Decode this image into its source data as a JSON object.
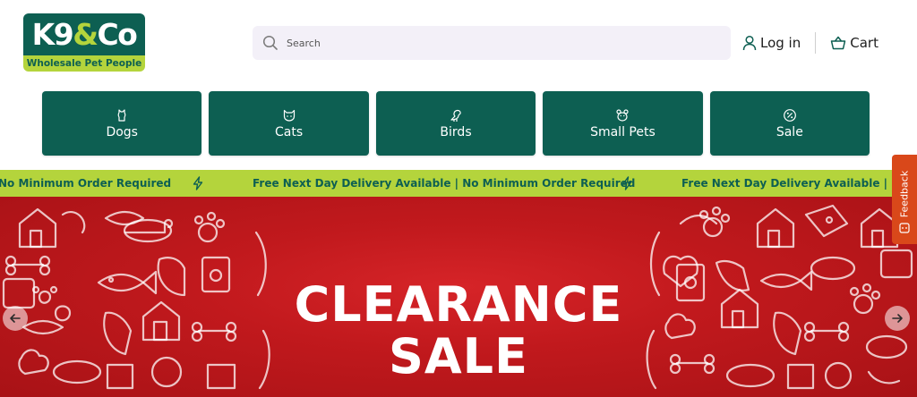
{
  "brand": {
    "name_left": "K9",
    "name_amp": "&",
    "name_right": "Co",
    "tagline": "Wholesale Pet People"
  },
  "search": {
    "placeholder": "Search"
  },
  "header": {
    "login_label": "Log in",
    "cart_label": "Cart"
  },
  "categories": [
    {
      "label": "Dogs",
      "icon": "dog-icon"
    },
    {
      "label": "Cats",
      "icon": "cat-icon"
    },
    {
      "label": "Birds",
      "icon": "bird-icon"
    },
    {
      "label": "Small Pets",
      "icon": "small-pet-icon"
    },
    {
      "label": "Sale",
      "icon": "percent-icon"
    }
  ],
  "announcement": {
    "fragment": "No Minimum Order Required",
    "message": "Free Next Day Delivery Available | No Minimum Order Required",
    "message_truncated": "Free Next Day Delivery Available | No Mi"
  },
  "hero": {
    "line1": "CLEARANCE",
    "line2": "SALE"
  },
  "feedback": {
    "label": "Feedback"
  },
  "colors": {
    "brand_green": "#0d5f52",
    "lime": "#b4d43c",
    "hero_red": "#c1191d",
    "feedback_orange": "#d9481a"
  }
}
